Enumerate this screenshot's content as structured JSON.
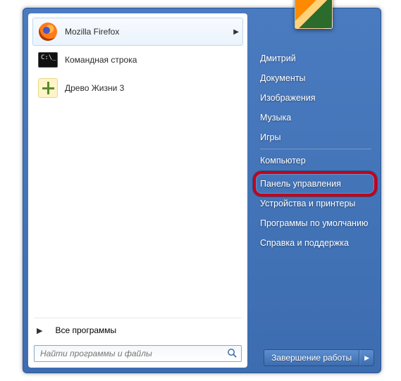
{
  "programs": [
    {
      "label": "Mozilla Firefox",
      "icon": "firefox-icon",
      "has_submenu": true
    },
    {
      "label": "Командная строка",
      "icon": "cmd-icon",
      "has_submenu": false
    },
    {
      "label": "Древо Жизни 3",
      "icon": "tree-icon",
      "has_submenu": false
    }
  ],
  "all_programs_label": "Все программы",
  "search": {
    "placeholder": "Найти программы и файлы"
  },
  "user": {
    "name": "Дмитрий"
  },
  "right_items": [
    "Документы",
    "Изображения",
    "Музыка",
    "Игры",
    "Компьютер",
    "Панель управления",
    "Устройства и принтеры",
    "Программы по умолчанию",
    "Справка и поддержка"
  ],
  "right_separators_after": [
    3,
    4
  ],
  "highlighted_right_index": 5,
  "shutdown_label": "Завершение работы"
}
